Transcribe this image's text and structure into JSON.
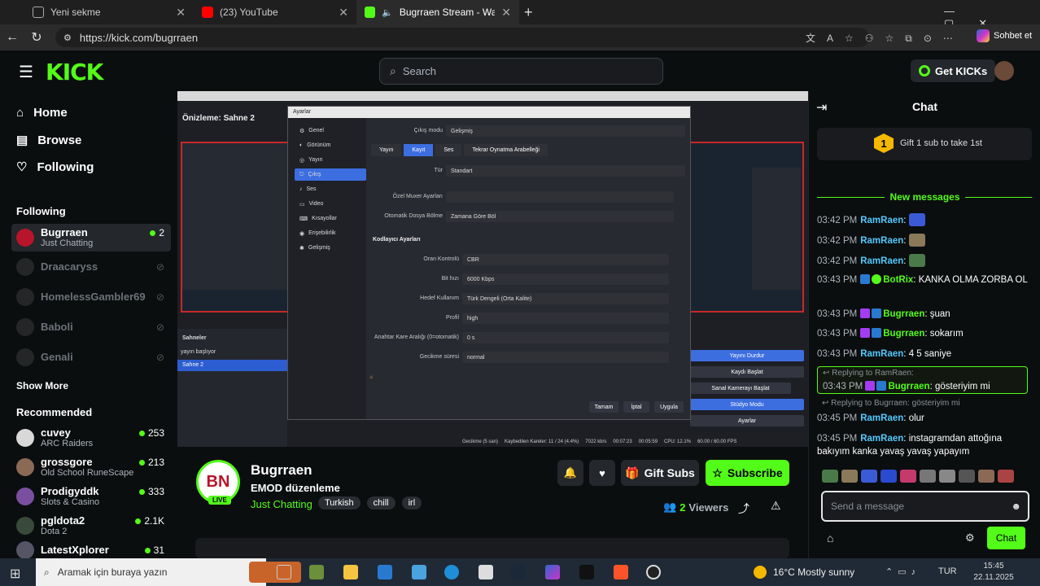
{
  "browser": {
    "tabs": [
      {
        "label": "Yeni sekme",
        "icon": "edge-newtab-icon",
        "color": "#3a6fd8"
      },
      {
        "label": "(23) YouTube",
        "icon": "youtube-icon",
        "color": "#ff0000"
      },
      {
        "label": "Bugrraen Stream - Watch Live on KICK",
        "icon": "kick-icon",
        "color": "#53fc18"
      }
    ],
    "url": "https://kick.com/bugrraen",
    "copilot_label": "Sohbet et"
  },
  "kick": {
    "logo": "KICK",
    "search_placeholder": "Search",
    "get_kicks": "Get KICKs",
    "nav": [
      {
        "label": "Home",
        "icon": "home-icon"
      },
      {
        "label": "Browse",
        "icon": "browse-icon"
      },
      {
        "label": "Following",
        "icon": "heart-icon"
      }
    ],
    "following_heading": "Following",
    "following": [
      {
        "name": "Bugrraen",
        "category": "Just Chatting",
        "viewers": "2",
        "live": true
      },
      {
        "name": "Draacaryss",
        "live": false
      },
      {
        "name": "HomelessGambler69",
        "live": false
      },
      {
        "name": "Baboli",
        "live": false
      },
      {
        "name": "Genali",
        "live": false
      }
    ],
    "show_more": "Show More",
    "recommended_heading": "Recommended",
    "recommended": [
      {
        "name": "cuvey",
        "category": "ARC Raiders",
        "viewers": "253"
      },
      {
        "name": "grossgore",
        "category": "Old School RuneScape",
        "viewers": "213"
      },
      {
        "name": "Prodigyddk",
        "category": "Slots & Casino",
        "viewers": "333"
      },
      {
        "name": "pgldota2",
        "category": "Dota 2",
        "viewers": "2.1K"
      },
      {
        "name": "LatestXplorer",
        "category": "",
        "viewers": "31"
      }
    ]
  },
  "stream": {
    "avatar_text": "BN",
    "live_badge": "LIVE",
    "streamer": "Bugrraen",
    "title": "EMOD düzenleme",
    "category": "Just Chatting",
    "tags": [
      "Turkish",
      "chill",
      "irl"
    ],
    "gift_subs": "Gift Subs",
    "subscribe": "Subscribe",
    "viewers": "2",
    "viewers_label": "Viewers"
  },
  "obs": {
    "preview_label": "Önizleme: Sahne 2",
    "dialog_title": "Ayarlar",
    "menu": [
      "Genel",
      "Görünüm",
      "Yayın",
      "Çıkış",
      "Ses",
      "Video",
      "Kısayollar",
      "Erişebilirlik",
      "Gelişmiş"
    ],
    "tabs": [
      "Yayın",
      "Kayıt",
      "Ses",
      "Tekrar Oynatma Arabelleği"
    ],
    "output_mode_label": "Çıkış modu",
    "output_mode": "Gelişmiş",
    "type_label": "Tür",
    "type_value": "Standart",
    "custom_muxer_label": "Özel Muxer Ayarları",
    "split_label": "Otomatik Dosya Bölme",
    "split_value": "Zamana Göre Böl",
    "encoder_section": "Kodlayıcı Ayarları",
    "fields": [
      {
        "label": "Oran Kontrolü",
        "value": "CBR"
      },
      {
        "label": "Bit hızı",
        "value": "6000 Kbps"
      },
      {
        "label": "Hedef Kullanım",
        "value": "Türk Dengeli (Orta Kalite)"
      },
      {
        "label": "Profil",
        "value": "high"
      },
      {
        "label": "Anahtar Kare Aralığı (0=otomatik)",
        "value": "0 s"
      },
      {
        "label": "Gecikme süresi",
        "value": "normal"
      }
    ],
    "buttons": [
      "Tamam",
      "İptal",
      "Uygula"
    ],
    "scenes_header": "Sahneler",
    "scenes": [
      "yayın başlıyor",
      "Sahne 2"
    ],
    "controls": [
      "Yayını Durdur",
      "Kaydı Başlat",
      "Sanal Kamerayı Başlat",
      "Stüdyo Modu",
      "Ayarlar"
    ],
    "status": [
      "Gecikme (5 san)",
      "Kaybedilen Kareler: 11 / 24 (4.4%)",
      "7022 kb/s",
      "00:07:23",
      "00:05:59",
      "CPU: 12.1%",
      "60.00 / 60.00 FPS"
    ]
  },
  "chat": {
    "title": "Chat",
    "gift_banner": "Gift 1 sub to take 1st",
    "gift_rank": "1",
    "new_messages": "New messages",
    "messages": [
      {
        "time": "03:42 PM",
        "user": "RamRaen",
        "text": "",
        "emote": "#3b5bd6"
      },
      {
        "time": "03:42 PM",
        "user": "RamRaen",
        "text": "",
        "emote": "#8a7a5a"
      },
      {
        "time": "03:42 PM",
        "user": "RamRaen",
        "text": "",
        "emote": "#4a7a4a"
      },
      {
        "time": "03:43 PM",
        "user": "BotRix",
        "text": "KANKA OLMA ZORBA OL"
      },
      {
        "time": "03:43 PM",
        "user": "Bugrraen",
        "text": "şuan"
      },
      {
        "time": "03:43 PM",
        "user": "Bugrraen",
        "text": "sokarım"
      },
      {
        "time": "03:43 PM",
        "user": "RamRaen",
        "text": "4 5 saniye"
      }
    ],
    "reply1_context": "Replying to RamRaen:",
    "reply1": {
      "time": "03:43 PM",
      "user": "Bugrraen",
      "text": "gösteriyim mi"
    },
    "reply2_context": "Replying to Bugrraen: gösteriyim mi",
    "reply2": {
      "time": "03:45 PM",
      "user": "RamRaen",
      "text": "olur"
    },
    "last": {
      "time": "03:45 PM",
      "user": "RamRaen",
      "text": "instagramdan attoğına bakıyım kanka yavaş yavaş yapayım"
    },
    "input_placeholder": "Send a message",
    "send_label": "Chat"
  },
  "taskbar": {
    "search_placeholder": "Aramak için buraya yazın",
    "weather": "16°C  Mostly sunny",
    "lang": "TUR",
    "time": "15:45",
    "date": "22.11.2025"
  },
  "colors": {
    "accent": "#53fc18",
    "background": "#0b0e0f",
    "panel": "#191b1f"
  }
}
